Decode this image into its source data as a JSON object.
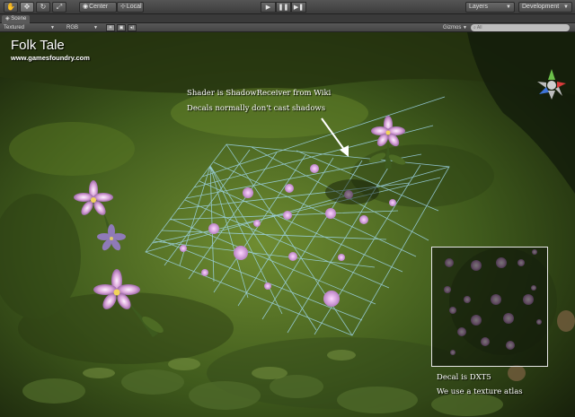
{
  "toolbar": {
    "tools": [
      {
        "name": "hand-tool",
        "icon": "✋"
      },
      {
        "name": "move-tool",
        "icon": "✥"
      },
      {
        "name": "rotate-tool",
        "icon": "↻"
      },
      {
        "name": "scale-tool",
        "icon": "⤢"
      }
    ],
    "pivot_label": "Center",
    "space_label": "Local",
    "play_icon": "▶",
    "pause_icon": "❚❚",
    "step_icon": "▶❚",
    "layers_label": "Layers",
    "layout_label": "Development"
  },
  "tabs": {
    "scene_label": "Scene"
  },
  "scene_options": {
    "render_mode": "Textured",
    "color_mode": "RGB",
    "gizmos_label": "Gizmos",
    "search_placeholder": "All"
  },
  "viewport": {
    "title": "Folk Tale",
    "subtitle": "www.gamesfoundry.com",
    "shader_note_1": "Shader is ShadowReceiver from Wiki",
    "shader_note_2": "Decals normally don't cast shadows",
    "atlas_note_1": "Decal is DXT5",
    "atlas_note_2": "We use a texture atlas"
  },
  "colors": {
    "grass_dark": "#1f2a10",
    "grass_mid": "#4a6422",
    "grass_light": "#7d9a3a",
    "mesh_line": "#9fd6ea",
    "flower_pink": "#d9a6d6"
  }
}
